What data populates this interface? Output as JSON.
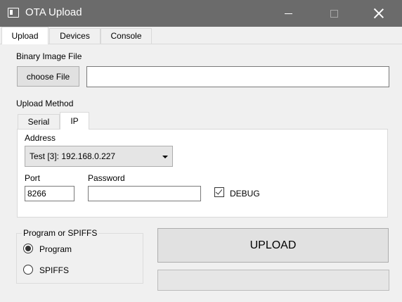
{
  "window": {
    "title": "OTA Upload"
  },
  "tabs": [
    {
      "label": "Upload",
      "active": true
    },
    {
      "label": "Devices",
      "active": false
    },
    {
      "label": "Console",
      "active": false
    }
  ],
  "upload": {
    "binary_label": "Binary Image File",
    "choose_file_label": "choose File",
    "file_path_value": "",
    "method_label": "Upload Method",
    "method_tabs": [
      {
        "label": "Serial",
        "active": false
      },
      {
        "label": "IP",
        "active": true
      }
    ],
    "address_label": "Address",
    "address_value": "Test [3]: 192.168.0.227",
    "port_label": "Port",
    "port_value": "8266",
    "password_label": "Password",
    "password_value": "",
    "debug_label": "DEBUG",
    "debug_checked": true,
    "program_group_label": "Program or SPIFFS",
    "radio_program_label": "Program",
    "radio_spiffs_label": "SPIFFS",
    "selected_target": "Program",
    "upload_button_label": "UPLOAD",
    "progress": 0
  },
  "colors": {
    "titlebar": "#6b6b6b",
    "window_bg": "#f0f0f0",
    "button_bg": "#e1e1e1"
  }
}
